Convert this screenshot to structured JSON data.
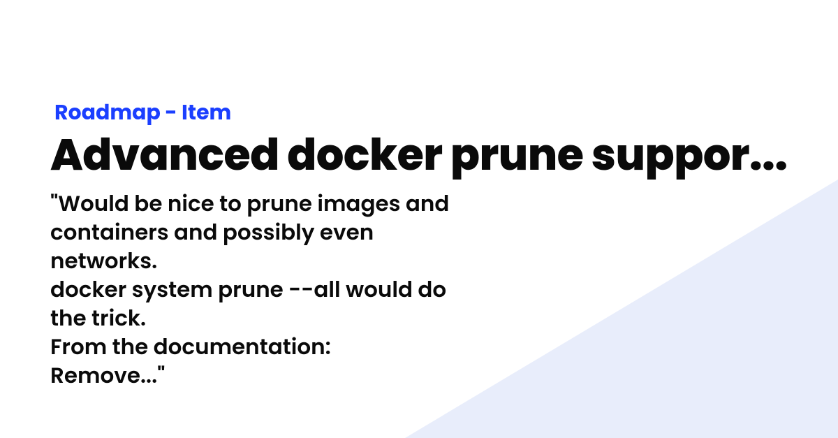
{
  "breadcrumb": "Roadmap - Item",
  "title": "Advanced docker prune suppor...",
  "description": "\"Would be nice to prune images and containers and possibly even networks.\ndocker system prune --all would do the trick.\nFrom the documentation:\nRemove...\""
}
